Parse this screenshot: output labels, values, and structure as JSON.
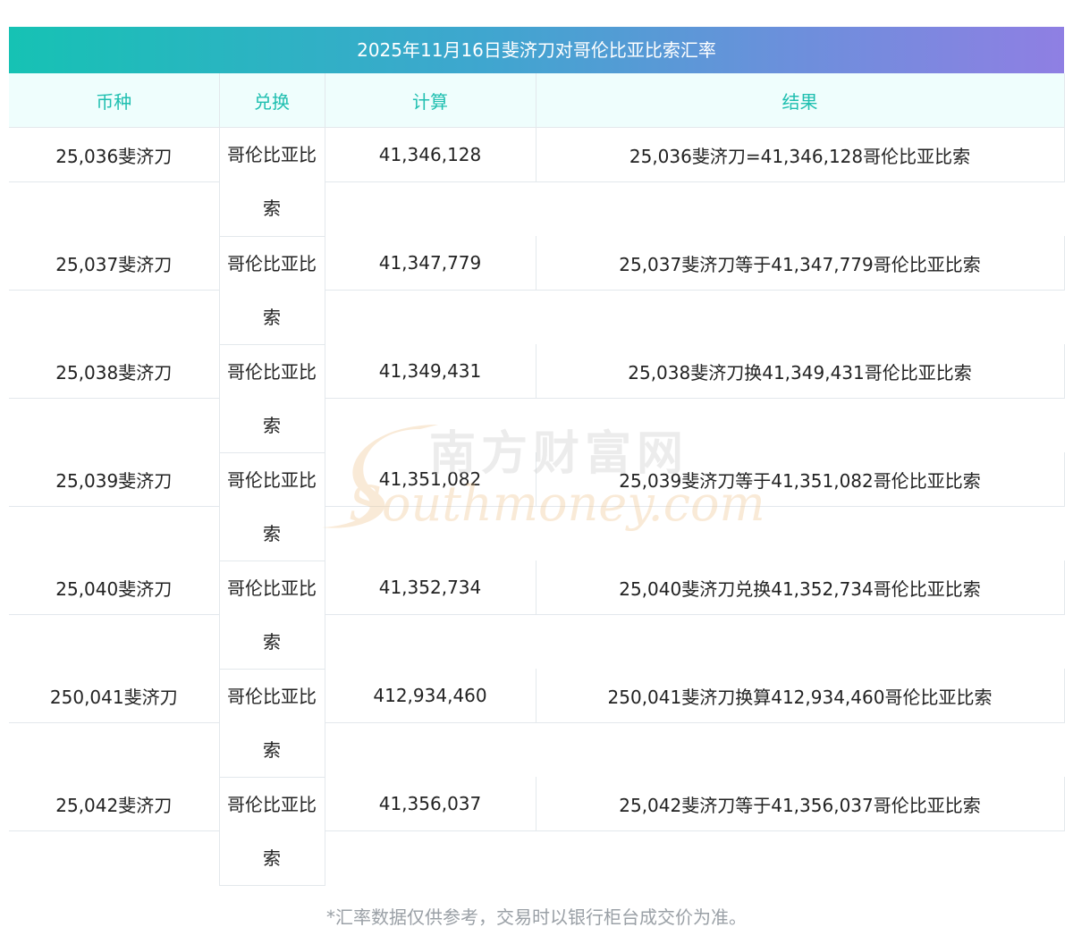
{
  "title": "2025年11月16日斐济刀对哥伦比亚比索汇率",
  "headers": [
    "币种",
    "兑换",
    "计算",
    "结果"
  ],
  "rows": [
    {
      "amount": "25,036斐济刀",
      "currency": "哥伦比亚比索",
      "calc": "41,346,128",
      "result": "25,036斐济刀=41,346,128哥伦比亚比索"
    },
    {
      "amount": "25,037斐济刀",
      "currency": "哥伦比亚比索",
      "calc": "41,347,779",
      "result": "25,037斐济刀等于41,347,779哥伦比亚比索"
    },
    {
      "amount": "25,038斐济刀",
      "currency": "哥伦比亚比索",
      "calc": "41,349,431",
      "result": "25,038斐济刀换41,349,431哥伦比亚比索"
    },
    {
      "amount": "25,039斐济刀",
      "currency": "哥伦比亚比索",
      "calc": "41,351,082",
      "result": "25,039斐济刀等于41,351,082哥伦比亚比索"
    },
    {
      "amount": "25,040斐济刀",
      "currency": "哥伦比亚比索",
      "calc": "41,352,734",
      "result": "25,040斐济刀兑换41,352,734哥伦比亚比索"
    },
    {
      "amount": "250,041斐济刀",
      "currency": "哥伦比亚比索",
      "calc": "412,934,460",
      "result": "250,041斐济刀换算412,934,460哥伦比亚比索"
    },
    {
      "amount": "25,042斐济刀",
      "currency": "哥伦比亚比索",
      "calc": "41,356,037",
      "result": "25,042斐济刀等于41,356,037哥伦比亚比索"
    }
  ],
  "footnote": "*汇率数据仅供参考，交易时以银行柜台成交价为准。",
  "watermark": {
    "cn_text": "南方财富网",
    "en_text": "Southmoney.com"
  },
  "colors": {
    "header_text": "#1fbfb0",
    "header_bg": "#effefd",
    "title_gradient_start": "#16c2b4",
    "title_gradient_end": "#8f7fe3",
    "footnote": "#9aa0a6",
    "watermark": "#e8a86a"
  }
}
